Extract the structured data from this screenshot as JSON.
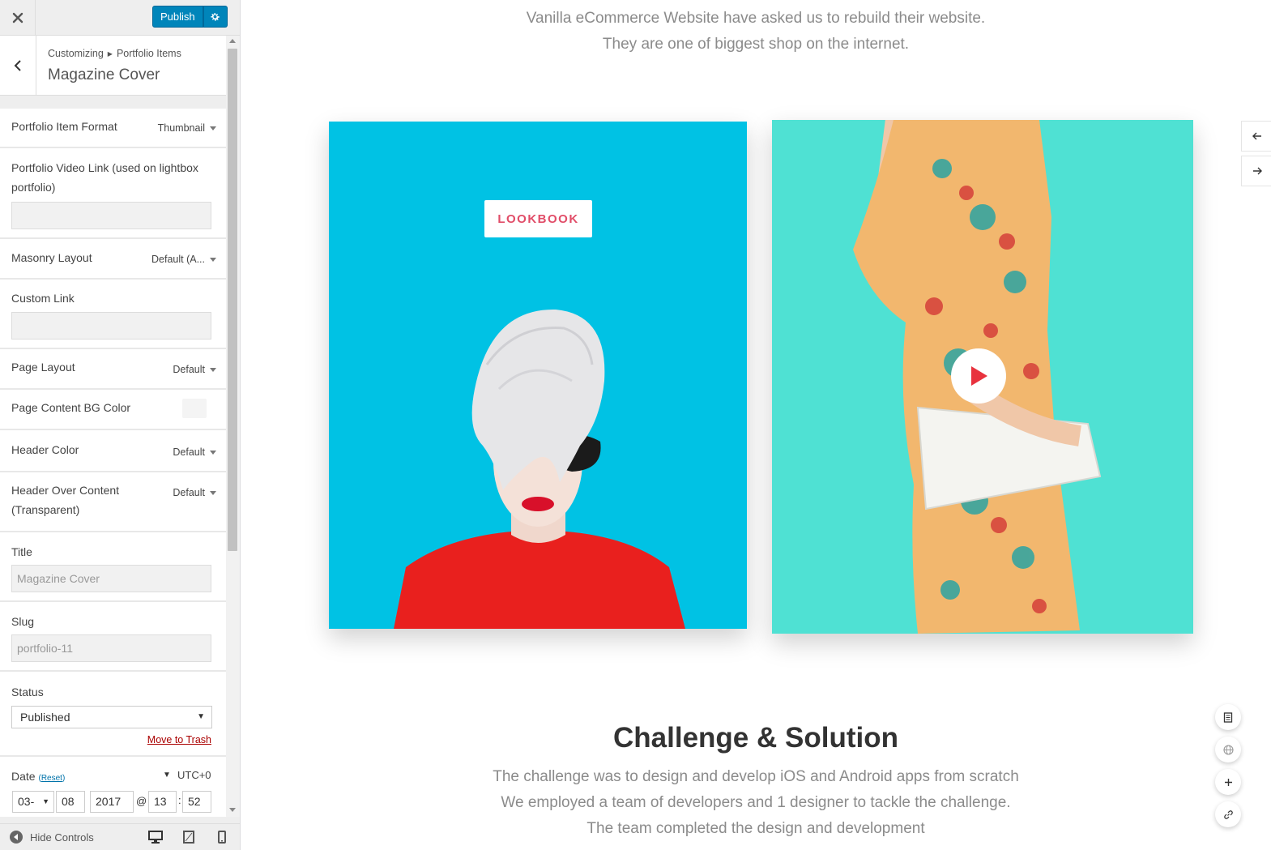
{
  "topbar": {
    "close_icon": "close-icon",
    "publish_label": "Publish",
    "settings_icon": "gear-icon"
  },
  "section": {
    "breadcrumb_root": "Customizing",
    "breadcrumb_parent": "Portfolio Items",
    "title": "Magazine Cover"
  },
  "controls": {
    "format_label": "Portfolio Item Format",
    "format_value": "Thumbnail",
    "video_label": "Portfolio Video Link (used on lightbox portfolio)",
    "video_value": "",
    "masonry_label": "Masonry Layout",
    "masonry_value": "Default (A...",
    "custom_link_label": "Custom Link",
    "custom_link_value": "",
    "page_layout_label": "Page Layout",
    "page_layout_value": "Default",
    "bg_color_label": "Page Content BG Color",
    "bg_color_value": "#f4f4f4",
    "header_color_label": "Header Color",
    "header_color_value": "Default",
    "header_over_label": "Header Over Content (Transparent)",
    "header_over_value": "Default",
    "title_label": "Title",
    "title_value": "Magazine Cover",
    "slug_label": "Slug",
    "slug_value": "portfolio-11",
    "status_label": "Status",
    "status_value": "Published",
    "trash_label": "Move to Trash",
    "date_label": "Date",
    "date_reset": "Reset",
    "timezone": "UTC+0",
    "date_month": "03-",
    "date_day": "08",
    "date_year": "2017",
    "date_at": "@",
    "date_hour": "13",
    "date_colon": ":",
    "date_minute": "52",
    "date_comma": ","
  },
  "footer": {
    "hide_controls_label": "Hide Controls"
  },
  "preview": {
    "intro_line1": "Vanilla eCommerce Website have asked us to rebuild their website.",
    "intro_line2": "They are one of biggest shop on the internet.",
    "lookbook_label": "LOOKBOOK",
    "challenge_title": "Challenge & Solution",
    "challenge_line1": "The challenge was to design and develop iOS and Android apps from scratch",
    "challenge_line2": "We employed a team of developers and 1 designer to tackle the challenge.",
    "challenge_line3": "The team completed the design and development",
    "nav_prev_icon": "arrow-left-icon",
    "nav_next_icon": "arrow-right-icon"
  },
  "colors": {
    "accent": "#0085ba",
    "left_card_bg": "#00c2e4",
    "right_card_bg": "#4fe1d3",
    "lookbook_text": "#e14d68",
    "play_icon": "#e8323e"
  }
}
